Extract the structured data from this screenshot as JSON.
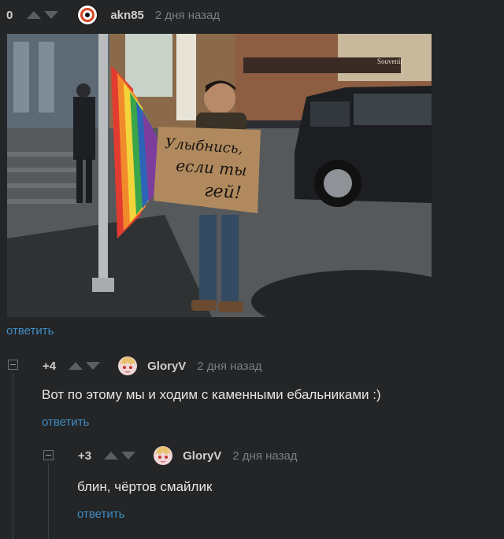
{
  "post": {
    "score": "0",
    "username": "akn85",
    "time": "2 дня назад",
    "sign_line1": "Улыбнись,",
    "sign_line2": "если ты",
    "sign_line3": "гей!",
    "shop_sign": "Souvenir",
    "reply_label": "ответить"
  },
  "comments": [
    {
      "score": "+4",
      "username": "GloryV",
      "time": "2 дня назад",
      "text": "Вот по этому мы и ходим с каменными ебальниками :)",
      "reply_label": "ответить"
    },
    {
      "score": "+3",
      "username": "GloryV",
      "time": "2 дня назад",
      "text": "блин, чёртов смайлик",
      "reply_label": "ответить"
    }
  ],
  "colors": {
    "background": "#232526",
    "link": "#3f8dc4",
    "username": "#cfcfcf",
    "muted": "#7b7f82"
  }
}
